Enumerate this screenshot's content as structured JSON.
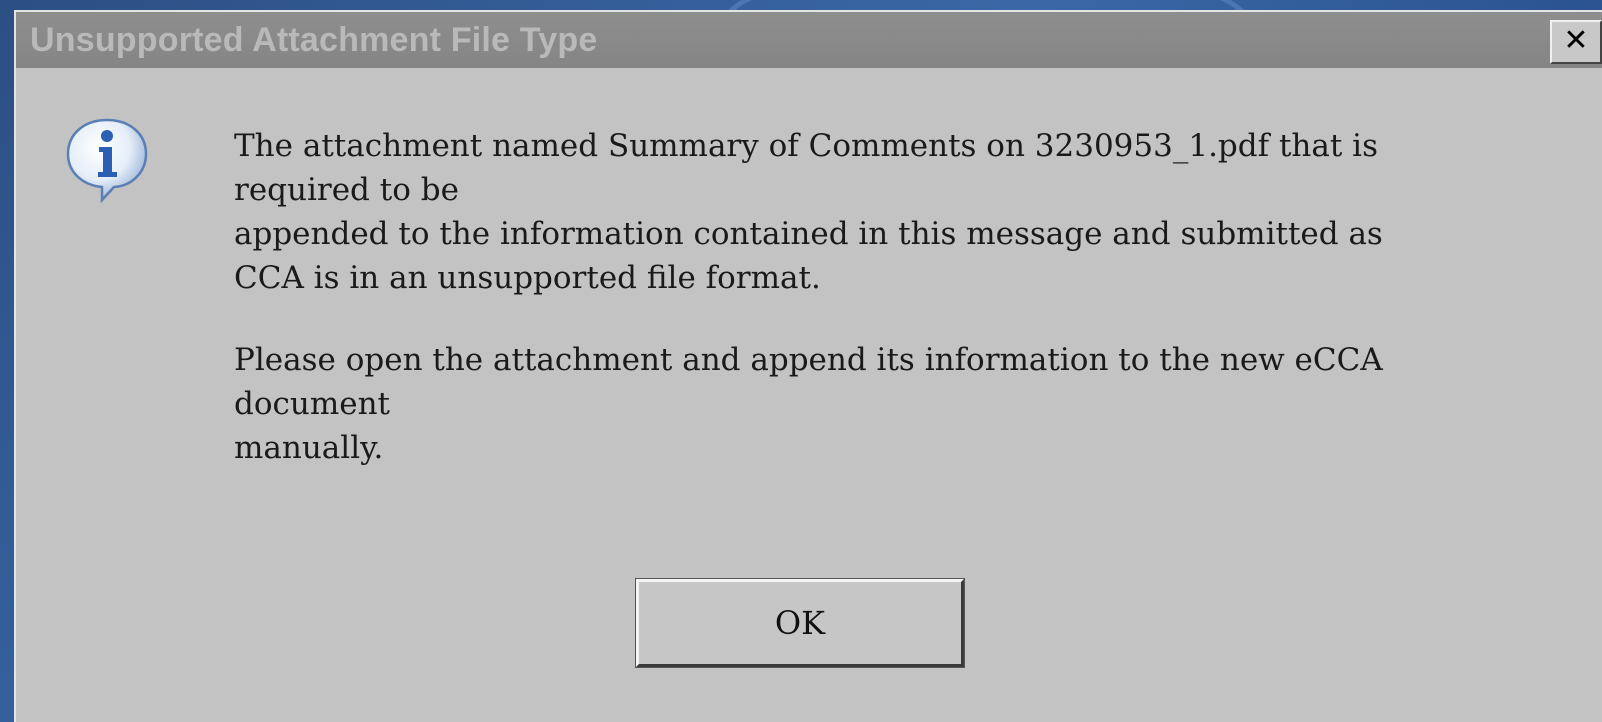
{
  "dialog": {
    "title": "Unsupported Attachment File Type",
    "close_label": "✕",
    "icon": "info-icon",
    "message_lines": [
      "The attachment named Summary of Comments on 3230953_1.pdf that is",
      "required to be",
      "appended to the information contained in this message and submitted as",
      "CCA is in an unsupported file format."
    ],
    "message_lines_2": [
      "Please open the attachment and append its information to the new eCCA",
      "document",
      "manually."
    ],
    "ok_label": "OK"
  },
  "colors": {
    "dialog_bg": "#c3c3c3",
    "titlebar_bg": "#8e8e8e",
    "title_text": "#b9b9b9",
    "desktop_bg": "#2f5587",
    "icon_blue": "#2a5fb3"
  }
}
